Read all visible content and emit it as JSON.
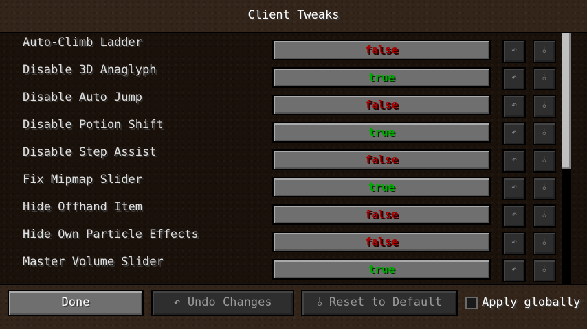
{
  "window": {
    "title": "Client Tweaks"
  },
  "rows": [
    {
      "label": "Auto-Climb Ladder",
      "value": "false"
    },
    {
      "label": "Disable 3D Anaglyph",
      "value": "true"
    },
    {
      "label": "Disable Auto Jump",
      "value": "false"
    },
    {
      "label": "Disable Potion Shift",
      "value": "true"
    },
    {
      "label": "Disable Step Assist",
      "value": "false"
    },
    {
      "label": "Fix Mipmap Slider",
      "value": "true"
    },
    {
      "label": "Hide Offhand Item",
      "value": "false"
    },
    {
      "label": "Hide Own Particle Effects",
      "value": "false"
    },
    {
      "label": "Master Volume Slider",
      "value": "true"
    }
  ],
  "row_icons": {
    "undo": "↶",
    "reset": "⫰"
  },
  "footer": {
    "done_label": "Done",
    "undo_label": "↶ Undo Changes",
    "reset_label": "⫰ Reset to Default",
    "apply_globally_label": "Apply globally"
  },
  "colors": {
    "false": "#aa0000",
    "true": "#00aa00"
  }
}
